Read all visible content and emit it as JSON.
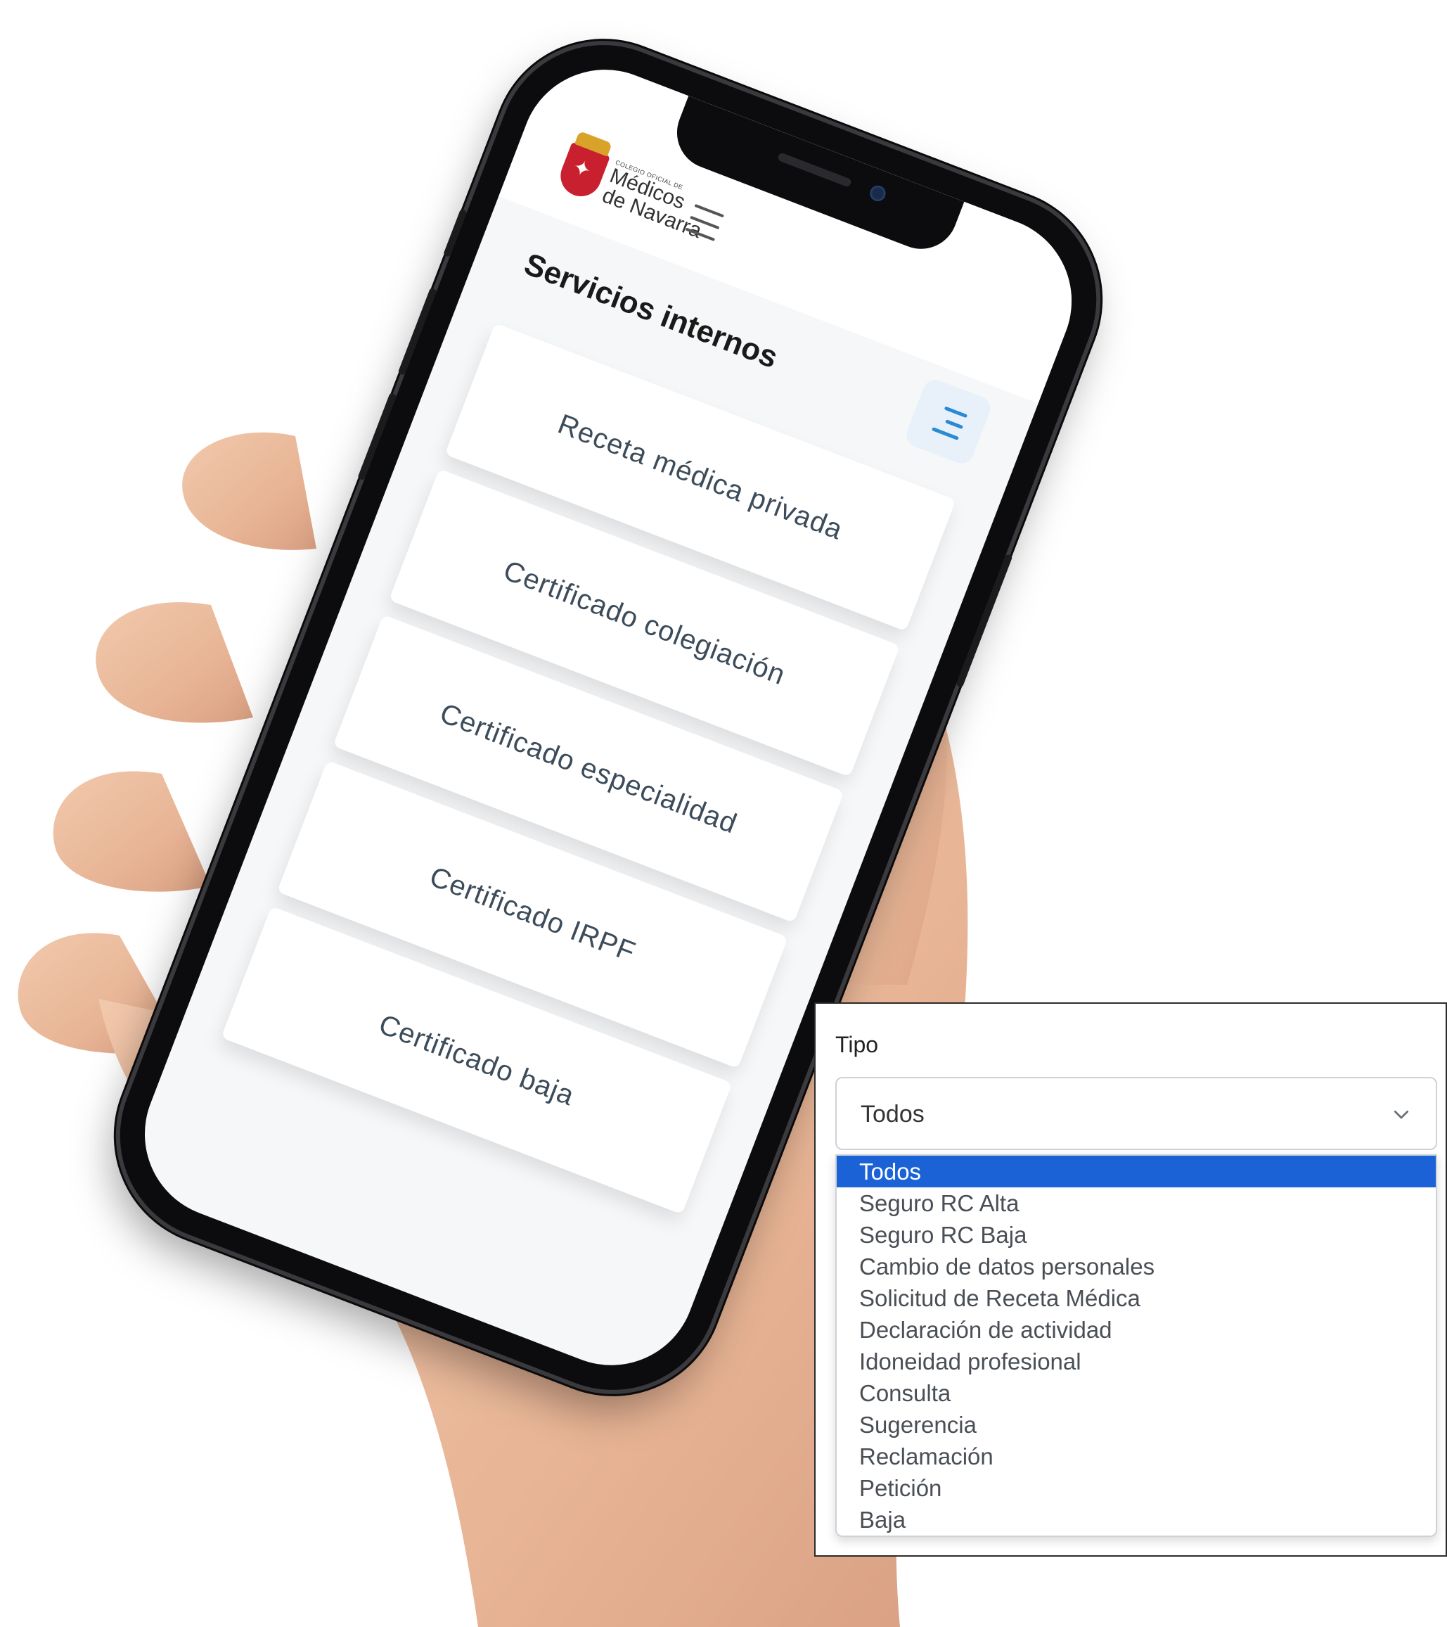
{
  "brand": {
    "small_text": "COLEGIO OFICIAL DE",
    "line1": "Médicos",
    "line2": "de Navarra"
  },
  "page": {
    "title": "Servicios internos"
  },
  "services": [
    {
      "label": "Receta médica privada"
    },
    {
      "label": "Certificado colegiación"
    },
    {
      "label": "Certificado especialidad"
    },
    {
      "label": "Certificado IRPF"
    },
    {
      "label": "Certificado baja"
    }
  ],
  "filter": {
    "label": "Tipo",
    "selected": "Todos",
    "options": [
      "Todos",
      "Seguro RC Alta",
      "Seguro RC Baja",
      "Cambio de datos personales",
      "Solicitud de Receta Médica",
      "Declaración de actividad",
      "Idoneidad profesional",
      "Consulta",
      "Sugerencia",
      "Reclamación",
      "Petición",
      "Baja"
    ]
  },
  "icons": {
    "header_menu": "hamburger-icon",
    "sidebar_toggle": "sidebar-toggle-icon",
    "select_chevron": "chevron-down-icon"
  },
  "colors": {
    "accent": "#1a62d6",
    "brand_red": "#c8202e",
    "toggle_blue": "#2a8ad4"
  }
}
